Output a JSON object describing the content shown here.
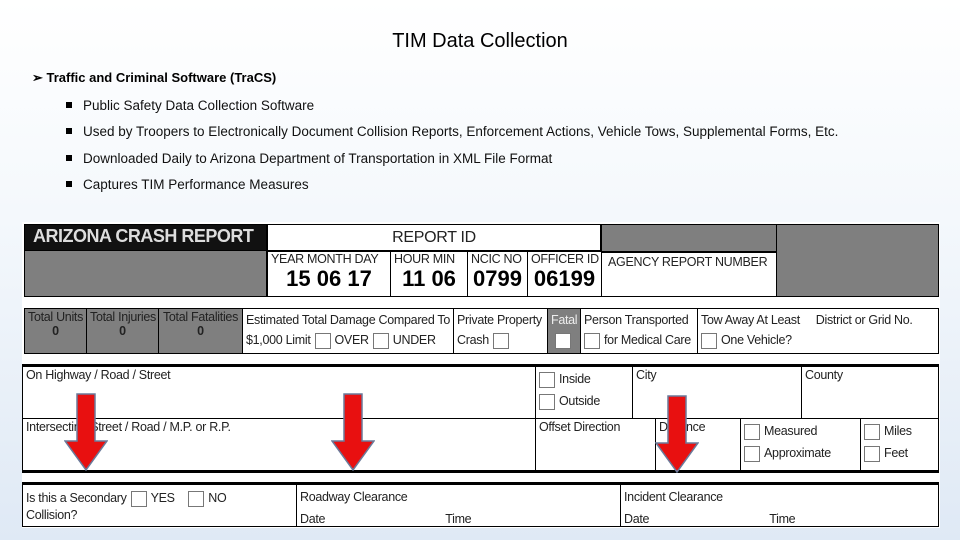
{
  "slide": {
    "title": "TIM Data Collection",
    "main_bullet": "Traffic and Criminal Software (TraCS)",
    "sub_bullets": [
      "Public Safety Data Collection Software",
      "Used by Troopers to Electronically Document Collision Reports, Enforcement Actions, Vehicle Tows, Supplemental Forms, Etc.",
      "Downloaded Daily to Arizona Department of Transportation in XML File Format",
      "Captures TIM Performance Measures"
    ]
  },
  "form": {
    "title": "ARIZONA CRASH REPORT",
    "report_id": "REPORT ID",
    "date_label": "YEAR  MONTH  DAY",
    "date_value": "15 06 17",
    "time_label": "HOUR  MIN",
    "time_value": "11 06",
    "ncic_label": "NCIC NO",
    "ncic_value": "0799",
    "officer_label": "OFFICER ID",
    "officer_value": "06199",
    "agency_label": "AGENCY REPORT NUMBER",
    "total_units": "Total Units",
    "total_units_value": "0",
    "total_injuries": "Total Injuries",
    "total_injuries_value": "0",
    "total_fatalities": "Total Fatalities",
    "total_fatalities_value": "0",
    "damage_label": "Estimated Total Damage Compared To",
    "damage_limit": "$1,000 Limit",
    "over": "OVER",
    "under": "UNDER",
    "private_property": "Private Property",
    "crash": "Crash",
    "fatal": "Fatal",
    "person_transported": "Person Transported",
    "medical_care": "for Medical Care",
    "tow_away": "Tow Away At Least",
    "one_vehicle": "One Vehicle?",
    "district": "District or Grid No.",
    "on_highway": "On Highway / Road / Street",
    "inside": "Inside",
    "outside": "Outside",
    "city": "City",
    "county": "County",
    "intersecting": "Intersecting Street / Road / M.P. or R.P.",
    "offset_direction": "Offset Direction",
    "distance": "Distance",
    "measured": "Measured",
    "approximate": "Approximate",
    "miles": "Miles",
    "feet": "Feet",
    "secondary": "Is this a Secondary",
    "collision": "Collision?",
    "yes": "YES",
    "no": "NO",
    "roadway_clearance": "Roadway Clearance",
    "incident_clearance": "Incident Clearance",
    "date": "Date",
    "time": "Time"
  },
  "colors": {
    "arrow": "#e81010",
    "gray": "#7f7f7f"
  }
}
